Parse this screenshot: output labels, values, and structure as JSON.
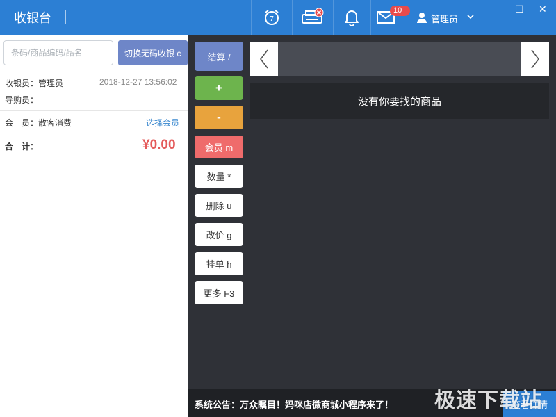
{
  "header": {
    "title": "收银台",
    "mail_badge": "10+",
    "user_name": "管理员",
    "win_min": "—",
    "win_max": "☐",
    "win_close": "✕"
  },
  "left": {
    "search_placeholder": "条码/商品编码/品名",
    "switch_label": "切换无码收银 c",
    "cashier_label": "收银员：",
    "cashier_value": "管理员",
    "datetime": "2018-12-27 13:56:02",
    "guide_label": "导购员：",
    "member_label": "会　员：",
    "member_value": "散客消费",
    "choose_member": "选择会员",
    "total_label": "合　计：",
    "total_value": "¥0.00"
  },
  "actions": {
    "checkout": "结算 /",
    "plus": "+",
    "minus": "-",
    "member": "会员 m",
    "quantity": "数量 *",
    "delete": "删除 u",
    "change_price": "改价 g",
    "hold": "挂单 h",
    "more": "更多 F3"
  },
  "main": {
    "empty_message": "没有你要找的商品"
  },
  "footer": {
    "announcement": "系统公告：万众瞩目！妈咪店微商城小程序来了！",
    "details": "查看详情"
  },
  "watermark": "极速下载站",
  "colors": {
    "header_blue": "#2c7fd4",
    "checkout_blue": "#6e86c8",
    "plus_green": "#6db44d",
    "minus_orange": "#e8a33d",
    "member_red": "#ef6b6b",
    "total_red": "#e45a5a",
    "dark_bg": "#2f3137"
  }
}
